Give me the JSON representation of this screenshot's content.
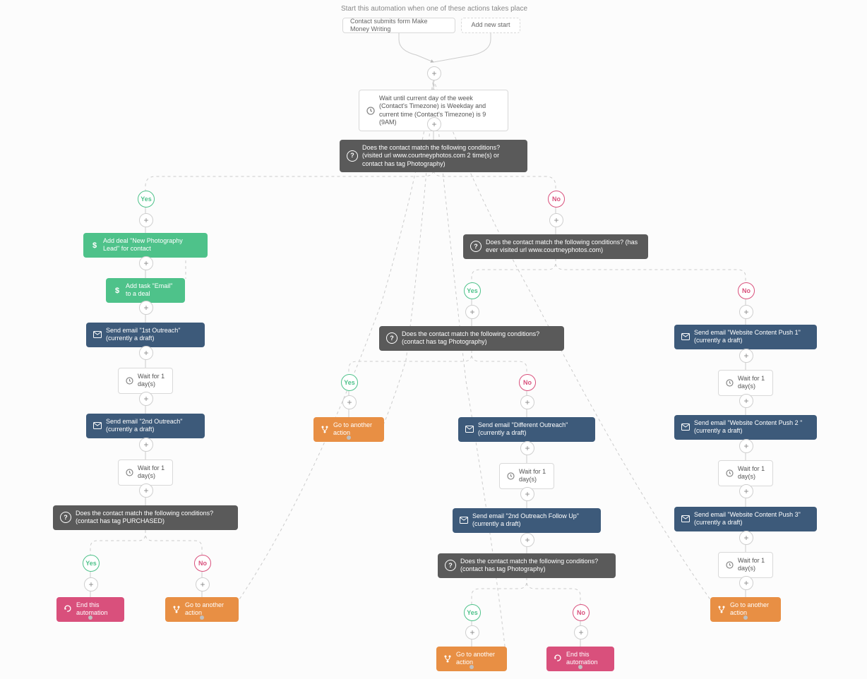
{
  "header": {
    "title": "Start this automation when one of these actions takes place"
  },
  "starts": {
    "trigger": "Contact submits form Make Money Writing",
    "add": "Add new start"
  },
  "wait1": "Wait until current day of the week (Contact's Timezone) is Weekday and current time (Contact's Timezone) is 9 (9AM)",
  "cond1": "Does the contact match the following conditions? (visited url www.courtneyphotos.com 2 time(s) or contact has tag Photography)",
  "cond2": "Does the contact match the following conditions? (has ever visited url www.courtneyphotos.com)",
  "cond3": "Does the contact match the following conditions? (contact has tag Photography)",
  "cond4": "Does the contact match the following conditions? (contact has tag PURCHASED)",
  "cond5": "Does the contact match the following conditions? (contact has tag Photography)",
  "labels": {
    "yes": "Yes",
    "no": "No"
  },
  "left": {
    "addDeal": "Add deal \"New Photography Lead\" for contact",
    "addTask": "Add task \"Email\" to a deal",
    "email1": "Send email \"1st Outreach\" (currently a draft)",
    "wait1": "Wait for 1 day(s)",
    "email2": "Send email \"2nd Outreach\" (currently a draft)",
    "wait2": "Wait for 1 day(s)",
    "end": "End this automation",
    "goto": "Go to another action"
  },
  "mid": {
    "goto1": "Go to another action",
    "email1": "Send email \"Different Outreach\" (currently a draft)",
    "wait1": "Wait for 1 day(s)",
    "email2": "Send email \"2nd Outreach Follow Up\" (currently a draft)",
    "goto2": "Go to another action",
    "end": "End this automation"
  },
  "right": {
    "email1": "Send email \"Website Content Push 1\" (currently a draft)",
    "wait1": "Wait for 1 day(s)",
    "email2": "Send email \"Website Content Push 2 \" (currently a draft)",
    "wait2": "Wait for 1 day(s)",
    "email3": "Send email \"Website Content Push 3\" (currently a draft)",
    "wait3": "Wait for 1 day(s)",
    "goto": "Go to another action"
  }
}
